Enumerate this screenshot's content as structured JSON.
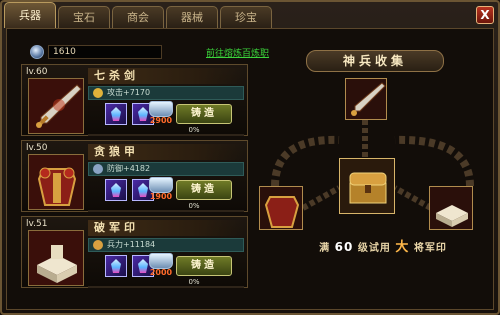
{
  "tabs": [
    {
      "label": "兵器",
      "active": true
    },
    {
      "label": "宝石",
      "active": false
    },
    {
      "label": "商会",
      "active": false
    },
    {
      "label": "器械",
      "active": false
    },
    {
      "label": "珍宝",
      "active": false
    }
  ],
  "close_label": "X",
  "gold": "1610",
  "refine_link": "前往熔炼百炼职",
  "items": [
    {
      "level": "lv.60",
      "name": "七杀剑",
      "stat": "攻击+7170",
      "cost": "2900",
      "forge_label": "铸造",
      "progress": "0%",
      "progress_value": 0
    },
    {
      "level": "lv.50",
      "name": "贪狼甲",
      "stat": "防御+4182",
      "cost": "1900",
      "forge_label": "铸造",
      "progress": "0%",
      "progress_value": 0
    },
    {
      "level": "lv.51",
      "name": "破军印",
      "stat": "兵力+11184",
      "cost": "2000",
      "forge_label": "铸造",
      "progress": "0%",
      "progress_value": 0
    }
  ],
  "right_panel": {
    "title": "神兵收集",
    "bonus_prefix": "满",
    "bonus_level": "60",
    "bonus_mid": "级试用",
    "bonus_big": "大",
    "bonus_suffix": "将军印"
  },
  "colors": {
    "accent": "#b89a5e",
    "link": "#3bd43b",
    "cost": "#ff6a2a"
  }
}
